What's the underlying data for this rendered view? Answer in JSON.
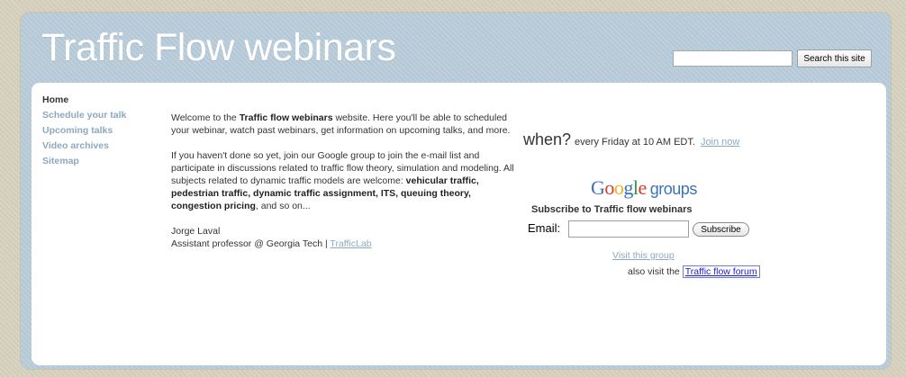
{
  "header": {
    "site_title": "Traffic Flow webinars",
    "search": {
      "value": "",
      "button_label": "Search this site"
    }
  },
  "nav": {
    "items": [
      {
        "label": "Home",
        "active": true
      },
      {
        "label": "Schedule your talk",
        "active": false
      },
      {
        "label": "Upcoming talks",
        "active": false
      },
      {
        "label": "Video archives",
        "active": false
      },
      {
        "label": "Sitemap",
        "active": false
      }
    ]
  },
  "main": {
    "intro": {
      "prefix": "Welcome to the ",
      "bold": "Traffic flow webinars",
      "suffix": " website. Here you'll be able to  scheduled your webinar, watch past webinars, get information on upcoming talks, and more."
    },
    "group_paragraph": {
      "prefix": "If you haven't done so yet, join our Google group to join the e-mail list and participate in discussions related to traffic flow theory, simulation and modeling. All subjects related to dynamic traffic models are welcome: ",
      "bold": "vehicular traffic, pedestrian traffic, dynamic traffic assignment, ITS, queuing theory, congestion pricing",
      "suffix": ", and so on..."
    },
    "signature": {
      "name": "Jorge Laval",
      "title": "Assistant professor @ Georgia Tech | ",
      "lab_link": "TrafficLab"
    }
  },
  "sidebar_right": {
    "when_word": "when?",
    "when_text": "every Friday at 10 AM EDT.",
    "join_link": "Join now",
    "google_logo": {
      "letters": [
        {
          "ch": "G",
          "color": "#3b73b9"
        },
        {
          "ch": "o",
          "color": "#d93a2c"
        },
        {
          "ch": "o",
          "color": "#f2b21c"
        },
        {
          "ch": "g",
          "color": "#3b73b9"
        },
        {
          "ch": "l",
          "color": "#2e9a47"
        },
        {
          "ch": "e",
          "color": "#d93a2c"
        }
      ],
      "groups_word": "groups"
    },
    "subscribe_heading": "Subscribe to Traffic flow webinars",
    "email_label": "Email:",
    "email_value": "",
    "subscribe_button": "Subscribe",
    "visit_group_link": "Visit this group",
    "forum_prefix": "also visit the ",
    "forum_link": "Traffic flow forum"
  },
  "colors": {
    "frame": "#b7cbd9",
    "nav_link": "#8da9bd",
    "outer_background": "#d8d2bf"
  }
}
